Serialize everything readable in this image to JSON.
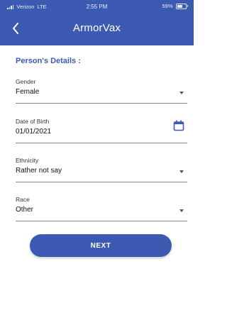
{
  "status_bar": {
    "carrier": "Verizon",
    "network": "LTE",
    "time": "2:55 PM",
    "battery": "59%"
  },
  "header": {
    "title": "ArmorVax",
    "back_icon": "back-chevron-icon"
  },
  "form": {
    "section_title": "Person's Details :",
    "fields": [
      {
        "label": "Gender",
        "value": "Female",
        "icon": "dropdown-caret-icon"
      },
      {
        "label": "Date of Birth",
        "value": "01/01/2021",
        "icon": "calendar-icon"
      },
      {
        "label": "Ethnicity",
        "value": "Rather not say",
        "icon": "dropdown-caret-icon"
      },
      {
        "label": "Race",
        "value": "Other",
        "icon": "dropdown-caret-icon"
      }
    ],
    "next_label": "NEXT"
  },
  "colors": {
    "primary": "#3d5ab2",
    "background": "#ffffff",
    "underline": "#8a8a8a"
  }
}
